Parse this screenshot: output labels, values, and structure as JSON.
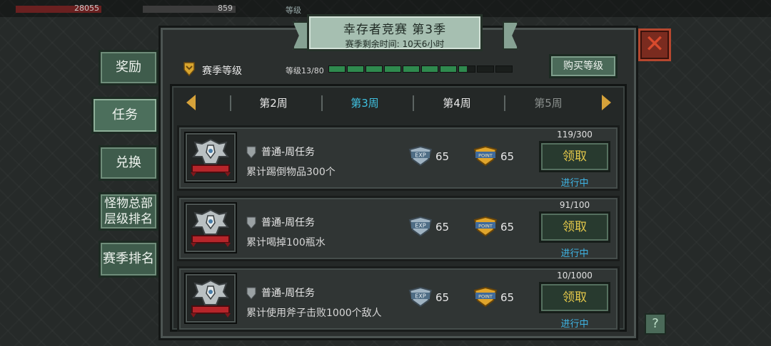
{
  "hud": {
    "hp": "28055",
    "resource": "859",
    "level": "等级"
  },
  "banner": {
    "title": "幸存者竞赛 第3季",
    "subtitle": "赛季剩余时间: 10天6小时"
  },
  "side_tabs": [
    "奖励",
    "任务",
    "兑换",
    "怪物总部\n层级排名",
    "赛季排名"
  ],
  "season": {
    "label": "赛季等级",
    "level_text": "等级13/80",
    "progress_filled_segments": 7.5,
    "progress_total_segments": 10,
    "buy_label": "购买等级"
  },
  "weeks": [
    {
      "label": "第2周",
      "state": "normal"
    },
    {
      "label": "第3周",
      "state": "active"
    },
    {
      "label": "第4周",
      "state": "normal"
    },
    {
      "label": "第5周",
      "state": "locked"
    }
  ],
  "tasks": [
    {
      "type": "普通-周任务",
      "desc": "累计踢倒物品300个",
      "exp": "65",
      "point": "65",
      "progress": "119/300",
      "claim": "领取",
      "status": "进行中"
    },
    {
      "type": "普通-周任务",
      "desc": "累计喝掉100瓶水",
      "exp": "65",
      "point": "65",
      "progress": "91/100",
      "claim": "领取",
      "status": "进行中"
    },
    {
      "type": "普通-周任务",
      "desc": "累计使用斧子击败1000个敌人",
      "exp": "65",
      "point": "65",
      "progress": "10/1000",
      "claim": "领取",
      "status": "进行中"
    }
  ],
  "close_label": "✕",
  "help_label": "?",
  "colors": {
    "active_week": "#3fc1e0",
    "status": "#3fb6e6",
    "claim_text": "#e4c84a",
    "progress_fill": "#2f8a4e",
    "close": "#7a2b1f"
  }
}
